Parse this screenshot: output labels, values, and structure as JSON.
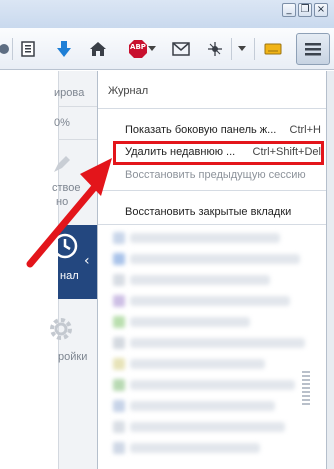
{
  "window": {
    "minimize_label": "_",
    "maximize_label": "❐",
    "close_label": "×"
  },
  "toolbar": {
    "icons": [
      "bookmarks-icon",
      "download-icon",
      "home-icon",
      "adblock-icon",
      "mail-icon",
      "extension-icon",
      "note-icon"
    ],
    "adblock_label": "ABP",
    "menu_icon": "hamburger-menu-icon"
  },
  "background_page": {
    "partial_text_1": "ировa",
    "partial_text_2": "0%",
    "partial_text_3": "ствое",
    "partial_text_4": "но",
    "history_label": "нал",
    "settings_label": "ройки"
  },
  "panel": {
    "title": "Журнал",
    "items": [
      {
        "label": "Показать боковую панель ж...",
        "shortcut": "Ctrl+H",
        "disabled": false
      },
      {
        "label": "Удалить недавнюю ...",
        "shortcut": "Ctrl+Shift+Del",
        "disabled": false
      },
      {
        "label": "Восстановить предыдущую сессию",
        "shortcut": "",
        "disabled": true
      },
      {
        "label": "Восстановить закрытые вкладки",
        "shortcut": "",
        "disabled": false
      }
    ]
  },
  "colors": {
    "highlight": "#e3151b",
    "history_tile": "#23477f",
    "adblock_red": "#c8102e"
  }
}
